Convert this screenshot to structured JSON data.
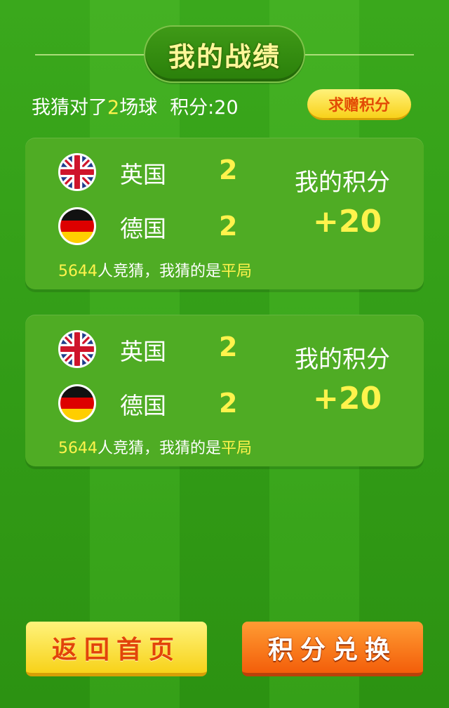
{
  "page": {
    "title": "我的战绩"
  },
  "summary": {
    "prefix": "我猜对了",
    "correct_count": "2",
    "suffix": "场球",
    "points_text": "积分:20"
  },
  "request_button": {
    "label": "求赠积分"
  },
  "matches": [
    {
      "team1": {
        "name": "英国",
        "score": "2",
        "flag": "uk-flag-icon"
      },
      "team2": {
        "name": "德国",
        "score": "2",
        "flag": "germany-flag-icon"
      },
      "points_label": "我的积分",
      "points_value": "+20",
      "guess_count": "5644",
      "guess_text": "人竞猜，我猜的是",
      "guess_choice": "平局"
    },
    {
      "team1": {
        "name": "英国",
        "score": "2",
        "flag": "uk-flag-icon"
      },
      "team2": {
        "name": "德国",
        "score": "2",
        "flag": "germany-flag-icon"
      },
      "points_label": "我的积分",
      "points_value": "+20",
      "guess_count": "5644",
      "guess_text": "人竞猜，我猜的是",
      "guess_choice": "平局"
    }
  ],
  "buttons": {
    "home": "返回首页",
    "exchange": "积分兑换"
  },
  "colors": {
    "highlight": "#fff34c",
    "background": "#3aa81c",
    "card": "#4fac24",
    "home_button": "#f7d219",
    "exchange_button": "#f35e0a"
  }
}
